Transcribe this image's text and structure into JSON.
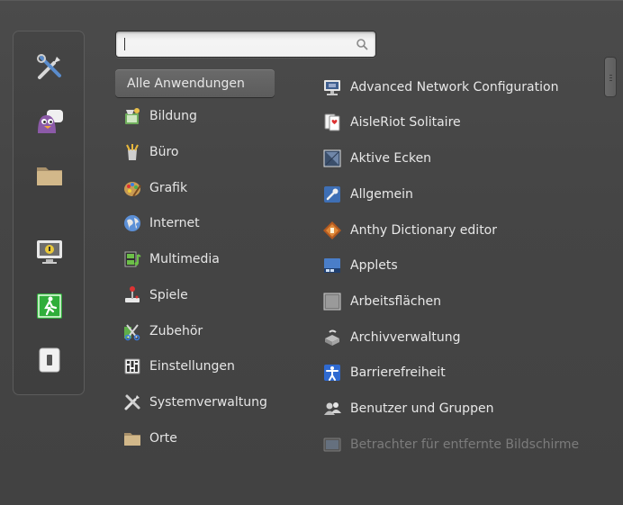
{
  "search": {
    "value": "",
    "placeholder": ""
  },
  "favorites": [
    {
      "name": "settings",
      "icon": "tools-icon"
    },
    {
      "name": "chat",
      "icon": "pidgin-icon"
    },
    {
      "name": "files",
      "icon": "folder-icon"
    },
    {
      "name": "lock-screen",
      "icon": "monitor-lock-icon"
    },
    {
      "name": "logout",
      "icon": "exit-icon"
    },
    {
      "name": "shutdown",
      "icon": "power-icon"
    }
  ],
  "categories": [
    {
      "label": "Alle Anwendungen",
      "icon": ""
    },
    {
      "label": "Bildung",
      "icon": "education-icon"
    },
    {
      "label": "Büro",
      "icon": "office-icon"
    },
    {
      "label": "Grafik",
      "icon": "graphics-icon"
    },
    {
      "label": "Internet",
      "icon": "globe-icon"
    },
    {
      "label": "Multimedia",
      "icon": "multimedia-icon"
    },
    {
      "label": "Spiele",
      "icon": "joystick-icon"
    },
    {
      "label": "Zubehör",
      "icon": "accessories-icon"
    },
    {
      "label": "Einstellungen",
      "icon": "settings-icon"
    },
    {
      "label": "Systemverwaltung",
      "icon": "tools-icon"
    },
    {
      "label": "Orte",
      "icon": "folder-icon"
    }
  ],
  "applications": [
    {
      "label": "Advanced Network Configuration",
      "icon": "network-icon"
    },
    {
      "label": "AisleRiot Solitaire",
      "icon": "cards-icon"
    },
    {
      "label": "Aktive Ecken",
      "icon": "hot-corners-icon"
    },
    {
      "label": "Allgemein",
      "icon": "general-settings-icon"
    },
    {
      "label": "Anthy Dictionary editor",
      "icon": "dictionary-icon"
    },
    {
      "label": "Applets",
      "icon": "applets-icon"
    },
    {
      "label": "Arbeitsflächen",
      "icon": "workspaces-icon"
    },
    {
      "label": "Archivverwaltung",
      "icon": "archive-icon"
    },
    {
      "label": "Barrierefreiheit",
      "icon": "accessibility-icon"
    },
    {
      "label": "Benutzer und Gruppen",
      "icon": "users-icon"
    },
    {
      "label": "Betrachter für entfernte Bildschirme",
      "icon": "remote-desktop-icon"
    }
  ]
}
